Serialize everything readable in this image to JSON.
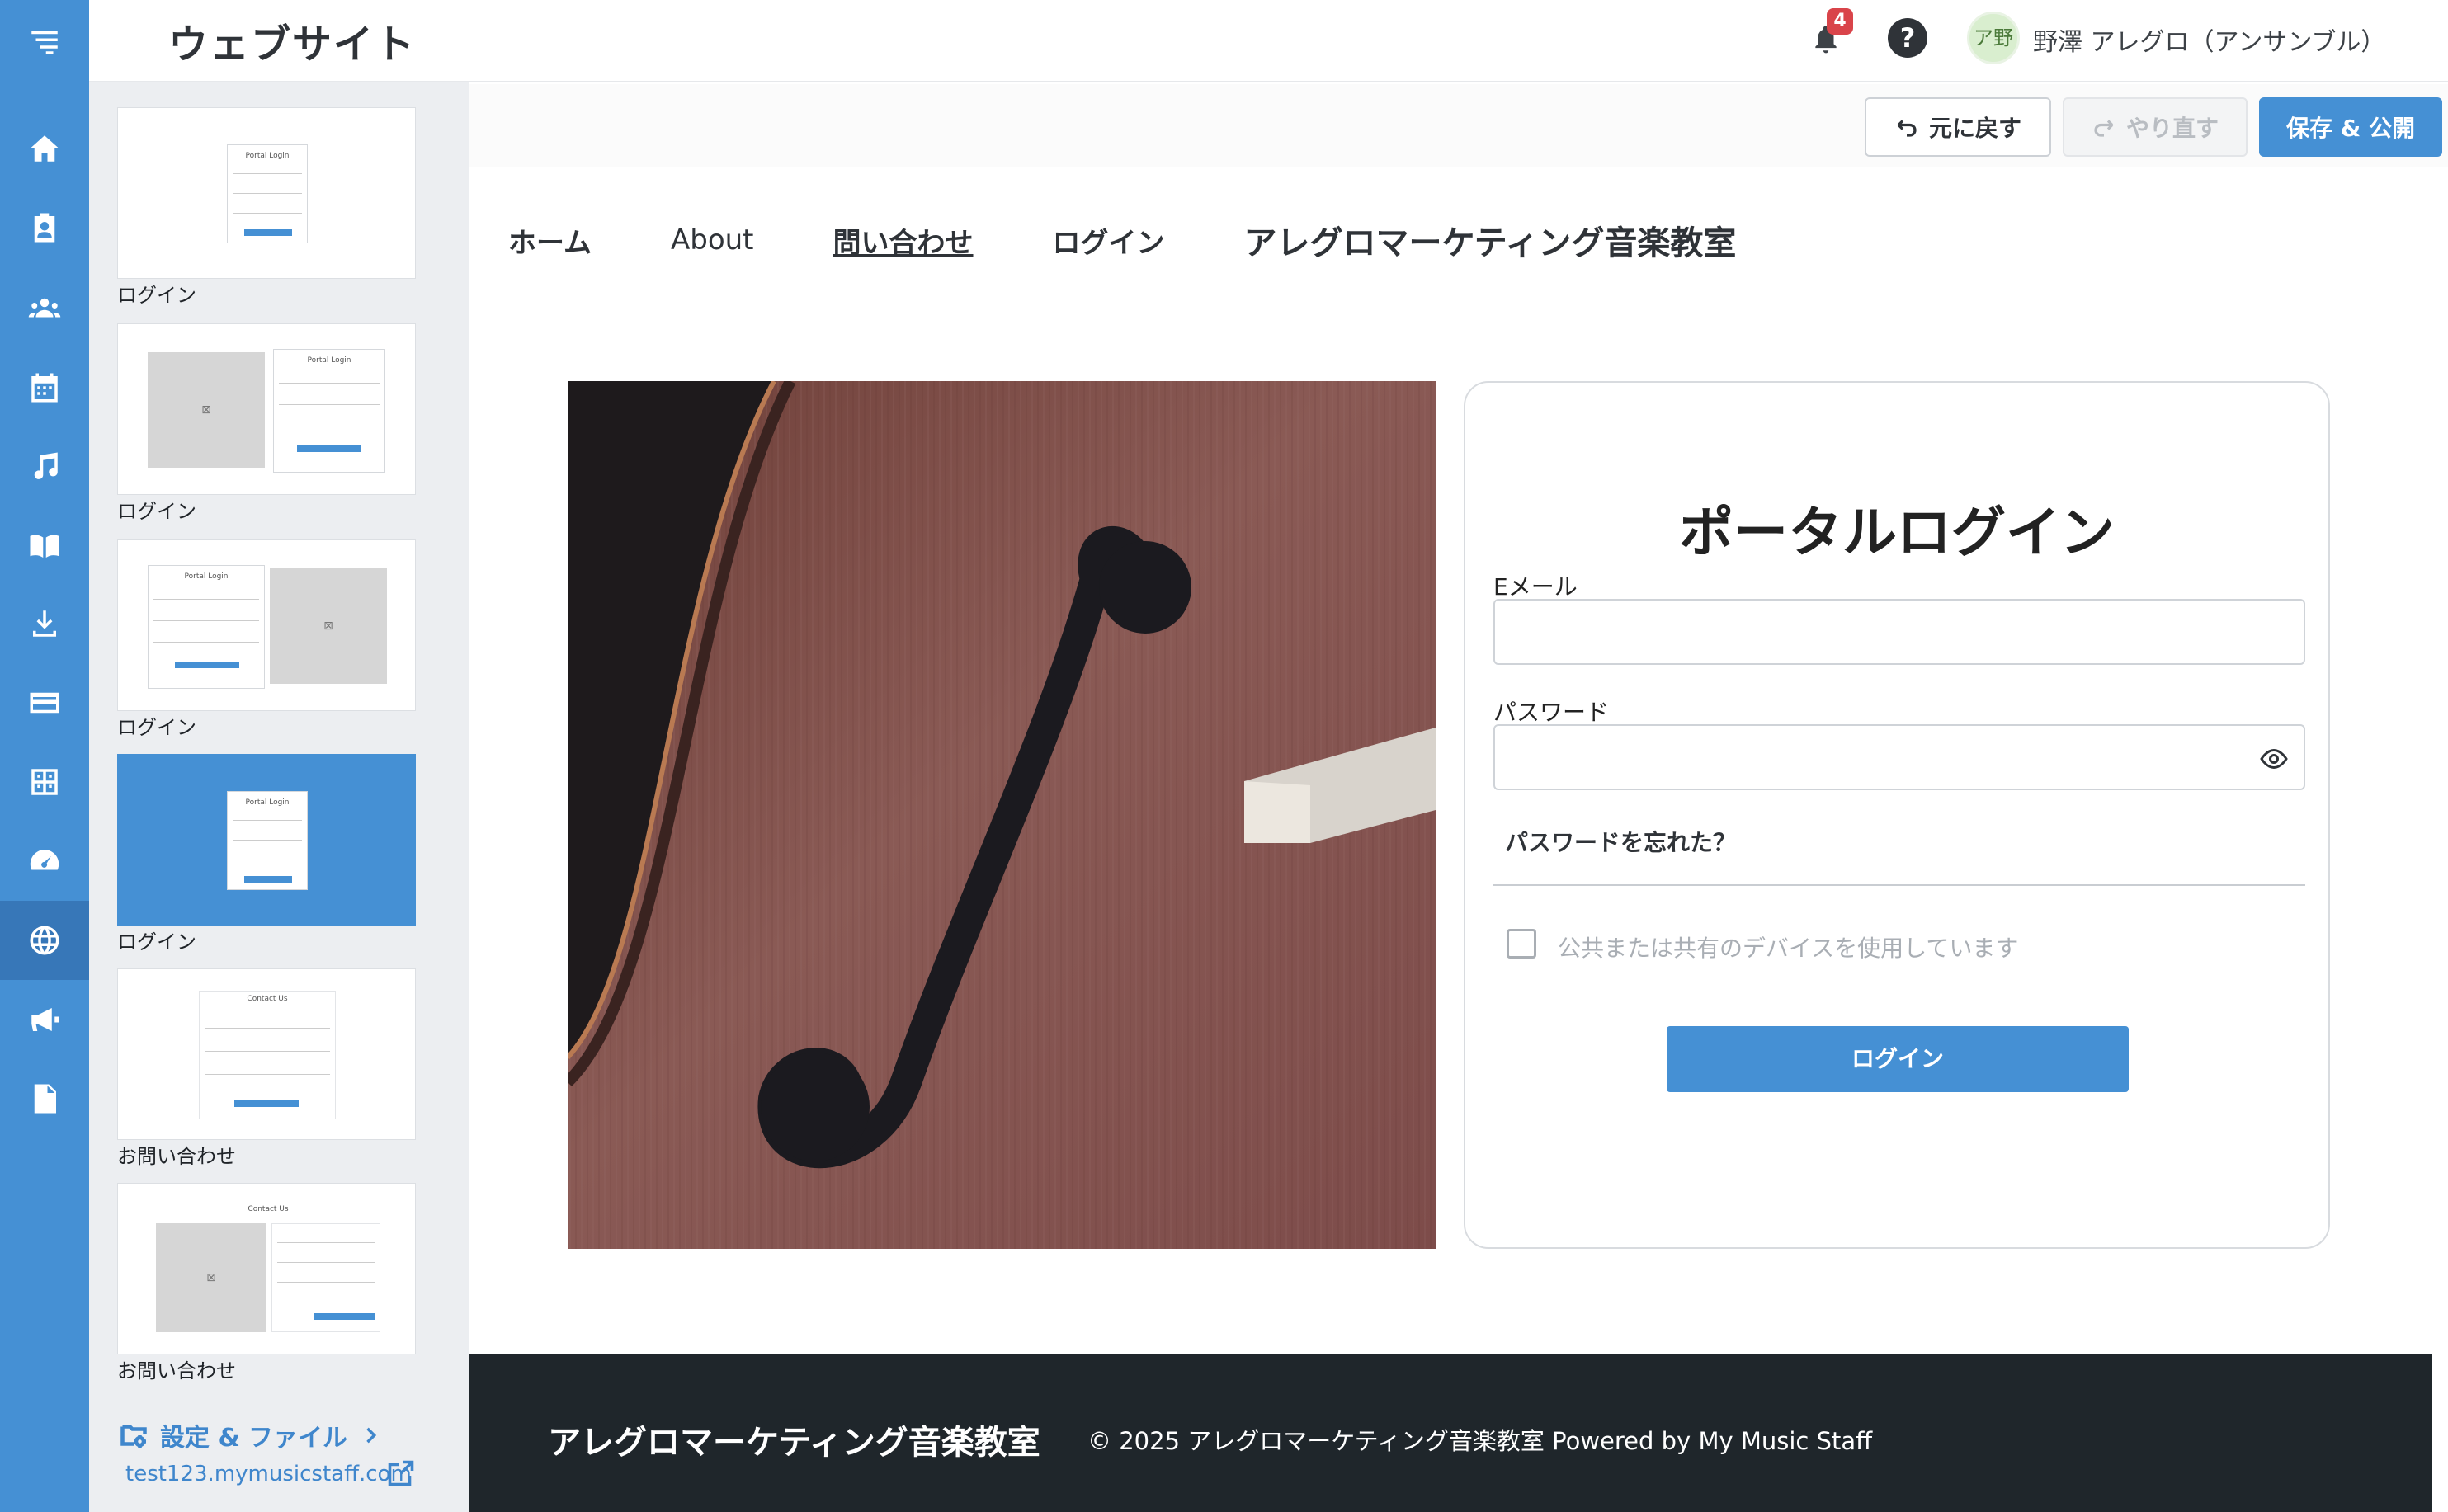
{
  "header": {
    "title": "ウェブサイト",
    "notification_count": "4",
    "help_label": "?",
    "avatar_initials": "ア野",
    "user_name": "野澤 アレグロ（アンサンブル）"
  },
  "rail": {
    "items": [
      {
        "icon": "menu-icon"
      },
      {
        "icon": "home-icon"
      },
      {
        "icon": "clipboard-user-icon"
      },
      {
        "icon": "users-icon"
      },
      {
        "icon": "calendar-icon"
      },
      {
        "icon": "music-note-icon"
      },
      {
        "icon": "book-icon"
      },
      {
        "icon": "download-icon"
      },
      {
        "icon": "credit-card-icon"
      },
      {
        "icon": "calculator-icon"
      },
      {
        "icon": "speedometer-icon"
      },
      {
        "icon": "globe-icon",
        "active": true
      },
      {
        "icon": "megaphone-icon"
      },
      {
        "icon": "document-icon"
      }
    ]
  },
  "panel": {
    "pages": [
      {
        "label": "ログイン",
        "mini_title": "Portal Login"
      },
      {
        "label": "ログイン",
        "mini_title": "Portal Login"
      },
      {
        "label": "ログイン",
        "mini_title": "Portal Login"
      },
      {
        "label": "ログイン",
        "mini_title": "Portal Login",
        "selected": true
      },
      {
        "label": "お問い合わせ",
        "mini_title": "Contact Us"
      },
      {
        "label": "お問い合わせ",
        "mini_title": "Contact Us"
      }
    ],
    "settings_label": "設定 & ファイル",
    "site_url": "test123.mymusicstaff.com"
  },
  "toolbar": {
    "undo_label": "元に戻す",
    "redo_label": "やり直す",
    "publish_label": "保存 & 公開"
  },
  "site": {
    "nav": {
      "home": "ホーム",
      "about": "About",
      "contact": "問い合わせ",
      "login": "ログイン",
      "brand": "アレグロマーケティング音楽教室"
    },
    "login": {
      "title": "ポータルログイン",
      "email_label": "Eメール",
      "email_value": "",
      "password_label": "パスワード",
      "password_value": "",
      "forgot_label": "パスワードを忘れた？",
      "shared_device_label": "公共または共有のデバイスを使用しています",
      "button_label": "ログイン"
    },
    "footer": {
      "brand": "アレグロマーケティング音楽教室",
      "copyright": "© 2025 アレグロマーケティング音楽教室 Powered by My Music Staff"
    }
  },
  "colors": {
    "accent": "#4590d4",
    "footer_bg": "#1f262b",
    "badge": "#d9444a"
  }
}
